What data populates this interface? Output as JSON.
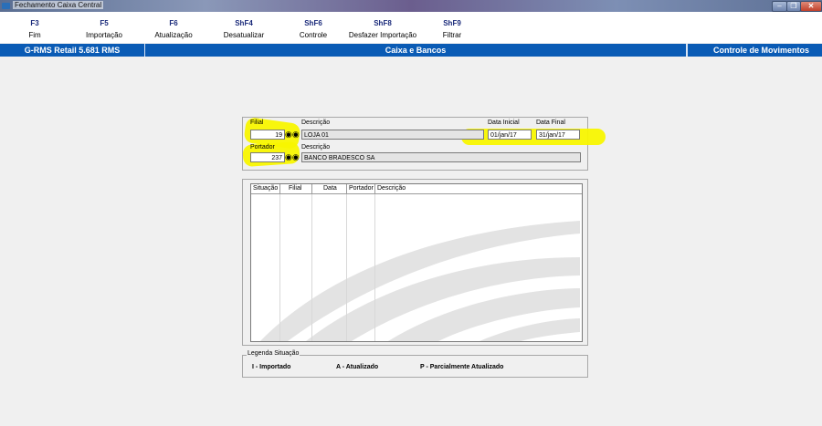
{
  "window": {
    "title": "Fechamento Caixa Central"
  },
  "toolbar": {
    "buttons": [
      {
        "key": "F3",
        "label": "Fim"
      },
      {
        "key": "F5",
        "label": "Importação"
      },
      {
        "key": "F6",
        "label": "Atualização"
      },
      {
        "key": "ShF4",
        "label": "Desatualizar"
      },
      {
        "key": "ShF6",
        "label": "Controle"
      },
      {
        "key": "ShF8",
        "label": "Desfazer Importação"
      },
      {
        "key": "ShF9",
        "label": "Filtrar"
      }
    ]
  },
  "header": {
    "system": "G-RMS Retail 5.681 RMS",
    "section": "Caixa e Bancos",
    "module": "Controle de Movimentos"
  },
  "filters": {
    "filial_label": "Filial",
    "filial_value": "19",
    "descricao_label": "Descrição",
    "filial_descricao": "LOJA 01",
    "data_inicial_label": "Data Inicial",
    "data_inicial_value": "01/jan/17",
    "data_final_label": "Data Final",
    "data_final_value": "31/jan/17",
    "portador_label": "Portador",
    "portador_value": "237",
    "portador_descricao_label": "Descrição",
    "portador_descricao": "BANCO BRADESCO SA"
  },
  "grid": {
    "columns": [
      "Situação",
      "Filial",
      "Data",
      "Portador",
      "Descrição"
    ],
    "rows": []
  },
  "legend": {
    "title": "Legenda Situação",
    "items": [
      "I - Importado",
      "A - Atualizado",
      "P - Parcialmente Atualizado"
    ]
  },
  "colors": {
    "header_band": "#0a5bb5",
    "highlight": "#f8f500",
    "key_text": "#1a2a7a"
  },
  "icons": {
    "lookup": "binoculars-icon"
  }
}
